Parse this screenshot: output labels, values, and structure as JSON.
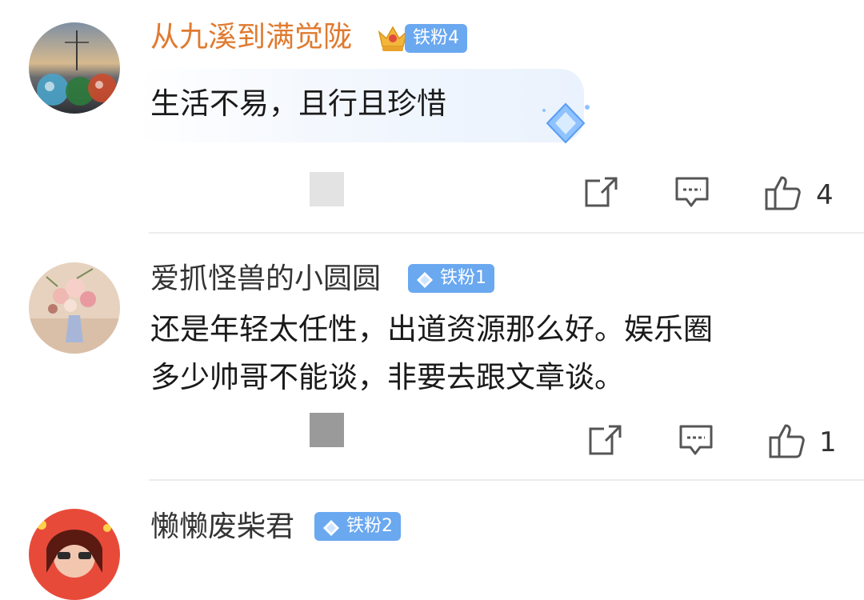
{
  "comments": [
    {
      "user": "从九溪到满觉陇",
      "badge": "铁粉4",
      "text_lines": [
        "生活不易，且行且珍惜"
      ],
      "likes": "4"
    },
    {
      "user": "爱抓怪兽的小圆圆",
      "badge": "铁粉1",
      "text_lines": [
        "还是年轻太任性，出道资源那么好。娱乐圈",
        "多少帅哥不能谈，非要去跟文章谈。"
      ],
      "likes": "1"
    },
    {
      "user": "懒懒废柴君",
      "badge": "铁粉2"
    }
  ],
  "colors": {
    "vip_name": "#e07a2f",
    "normal_name": "#333333",
    "badge_gold": "#f3b63b",
    "badge_blue": "#6aa8f0",
    "bubble": "#eef4fd",
    "icon": "#555555"
  },
  "icons": [
    "crown-icon",
    "diamond-icon",
    "share-icon",
    "comment-icon",
    "thumbs-up-icon"
  ]
}
